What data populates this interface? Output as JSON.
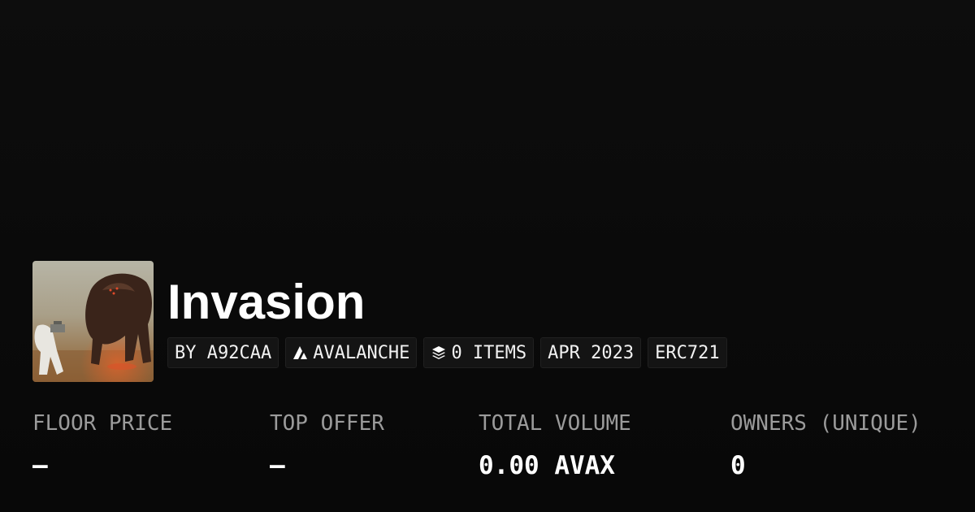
{
  "collection": {
    "name": "Invasion",
    "avatar_icon": "collection-artwork-alien-creature"
  },
  "badges": {
    "creator": "BY A92CAA",
    "chain": "AVALANCHE",
    "chain_icon": "avalanche-icon",
    "items": "0 ITEMS",
    "items_icon": "layers-icon",
    "created": "APR 2023",
    "standard": "ERC721"
  },
  "stats": {
    "floor_price": {
      "label": "FLOOR PRICE",
      "value": "–"
    },
    "top_offer": {
      "label": "TOP OFFER",
      "value": "–"
    },
    "total_volume": {
      "label": "TOTAL VOLUME",
      "value": "0.00 AVAX"
    },
    "owners": {
      "label": "OWNERS (UNIQUE)",
      "value": "0"
    }
  },
  "colors": {
    "background": "#0a0a0a",
    "badge_background": "#141414",
    "label_gray": "#9b9b9b",
    "text": "#ffffff"
  }
}
